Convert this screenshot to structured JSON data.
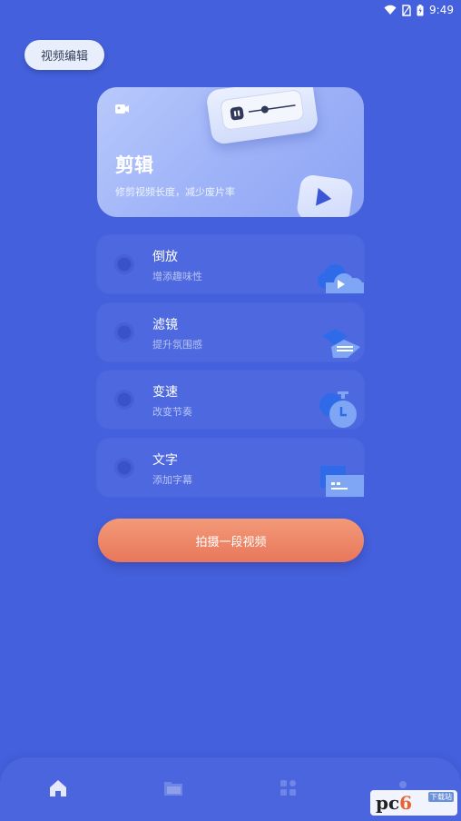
{
  "status_bar": {
    "time": "9:49"
  },
  "header": {
    "chip_label": "视频编辑"
  },
  "hero": {
    "title": "剪辑",
    "subtitle": "修剪视频长度，减少废片率"
  },
  "features": [
    {
      "name": "倒放",
      "desc": "增添趣味性",
      "icon": "cloud-play-icon"
    },
    {
      "name": "滤镜",
      "desc": "提升氛围感",
      "icon": "layers-icon"
    },
    {
      "name": "变速",
      "desc": "改变节奏",
      "icon": "stopwatch-icon"
    },
    {
      "name": "文字",
      "desc": "添加字幕",
      "icon": "text-card-icon"
    }
  ],
  "action": {
    "shoot_label": "拍摄一段视频"
  },
  "bottom_nav": {
    "items": [
      "home-icon",
      "folder-icon",
      "apps-icon",
      "profile-icon"
    ]
  },
  "watermark": {
    "brand": "pc6",
    "tag": "下载站"
  },
  "colors": {
    "background": "#4460dc",
    "card": "#4e69df",
    "accent_button": "#ec8163",
    "hero_card": "#a9bcf9"
  }
}
